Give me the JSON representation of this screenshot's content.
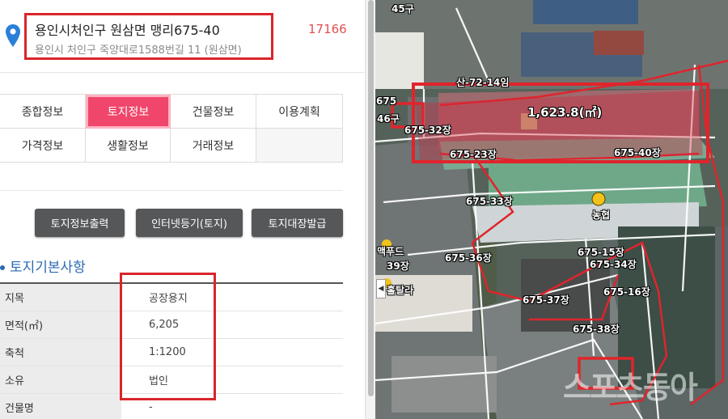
{
  "address": {
    "main": "용인시처인구 원삼면 맹리675-40",
    "sub": "용인시 처인구 죽양대로1588번길 11 (원삼면)",
    "code": "17166"
  },
  "tabs": [
    {
      "label": "종합정보",
      "active": false
    },
    {
      "label": "토지정보",
      "active": true
    },
    {
      "label": "건물정보",
      "active": false
    },
    {
      "label": "이용계획",
      "active": false
    },
    {
      "label": "가격정보",
      "active": false
    },
    {
      "label": "생활정보",
      "active": false
    },
    {
      "label": "거래정보",
      "active": false
    }
  ],
  "buttons": {
    "print": "토지정보출력",
    "registry": "인터넷등기(토지)",
    "ledger": "토지대장발급"
  },
  "section": {
    "title": "토지기본사항"
  },
  "land_info": [
    {
      "label": "지목",
      "value": "공장용지"
    },
    {
      "label": "면적(㎡)",
      "value": "6,205"
    },
    {
      "label": "축척",
      "value": "1:1200"
    },
    {
      "label": "소유",
      "value": "법인"
    },
    {
      "label": "건물명",
      "value": "-"
    }
  ],
  "map": {
    "area_label": "1,623.8(㎡)",
    "parcel_labels": [
      {
        "text": "45구"
      },
      {
        "text": "산-72-14임"
      },
      {
        "text": "46구"
      },
      {
        "text": "675"
      },
      {
        "text": "675-32장"
      },
      {
        "text": "675-23장"
      },
      {
        "text": "675-40장"
      },
      {
        "text": "675-33장"
      },
      {
        "text": "농협"
      },
      {
        "text": "맥푸드"
      },
      {
        "text": "39장"
      },
      {
        "text": "675-36장"
      },
      {
        "text": "675-15장"
      },
      {
        "text": "675-34장"
      },
      {
        "text": "홀탈라"
      },
      {
        "text": "675-37장"
      },
      {
        "text": "675-16장"
      },
      {
        "text": "675-38장"
      }
    ],
    "watermark": "스포츠동아"
  },
  "colors": {
    "accent": "#f0466b",
    "highlight": "#d9252b",
    "section": "#2b6ab3"
  }
}
